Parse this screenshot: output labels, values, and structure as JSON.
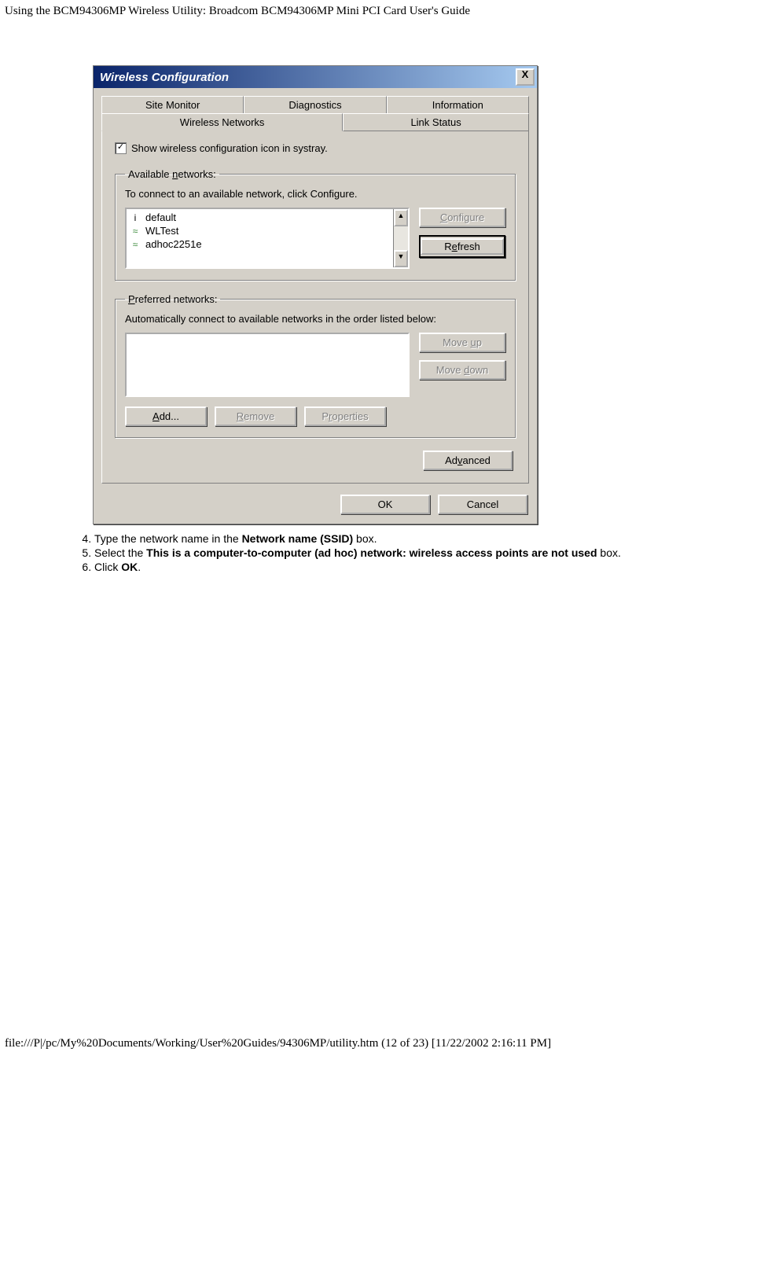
{
  "page_header": "Using the BCM94306MP Wireless Utility: Broadcom BCM94306MP Mini PCI Card User's Guide",
  "dialog": {
    "title": "Wireless Configuration",
    "close": "X",
    "tabs_top": [
      "Site Monitor",
      "Diagnostics",
      "Information"
    ],
    "tabs_bottom": [
      "Wireless Networks",
      "Link Status"
    ],
    "systray_check": "✓",
    "systray_label": "Show wireless configuration icon in systray.",
    "available": {
      "legend_pre": "Available ",
      "legend_u": "n",
      "legend_post": "etworks:",
      "hint": "To connect to an available network, click Configure.",
      "items": [
        {
          "icon": "i",
          "name": "default"
        },
        {
          "icon": "≈",
          "name": "WLTest"
        },
        {
          "icon": "≈",
          "name": "adhoc2251e"
        }
      ],
      "scroll_up": "▲",
      "scroll_down": "▼",
      "configure_u": "C",
      "configure_post": "onfigure",
      "refresh_pre": "R",
      "refresh_u": "e",
      "refresh_post": "fresh"
    },
    "preferred": {
      "legend_u": "P",
      "legend_post": "referred networks:",
      "hint": "Automatically connect to available networks in the order listed below:",
      "moveup_pre": "Move ",
      "moveup_u": "u",
      "moveup_post": "p",
      "movedown_pre": "Move ",
      "movedown_u": "d",
      "movedown_post": "own",
      "add_u": "A",
      "add_post": "dd...",
      "remove_u": "R",
      "remove_post": "emove",
      "props_pre": "P",
      "props_u": "r",
      "props_post": "operties"
    },
    "advanced_pre": "Ad",
    "advanced_u": "v",
    "advanced_post": "anced",
    "ok": "OK",
    "cancel": "Cancel"
  },
  "steps": {
    "s4_a": "Type the network name in the ",
    "s4_b": "Network name (SSID)",
    "s4_c": " box.",
    "s5_a": "Select the ",
    "s5_b": "This is a computer-to-computer (ad hoc) network: wireless access points are not used",
    "s5_c": " box.",
    "s6_a": "Click ",
    "s6_b": "OK",
    "s6_c": "."
  },
  "footer": "file:///P|/pc/My%20Documents/Working/User%20Guides/94306MP/utility.htm (12 of 23) [11/22/2002 2:16:11 PM]"
}
